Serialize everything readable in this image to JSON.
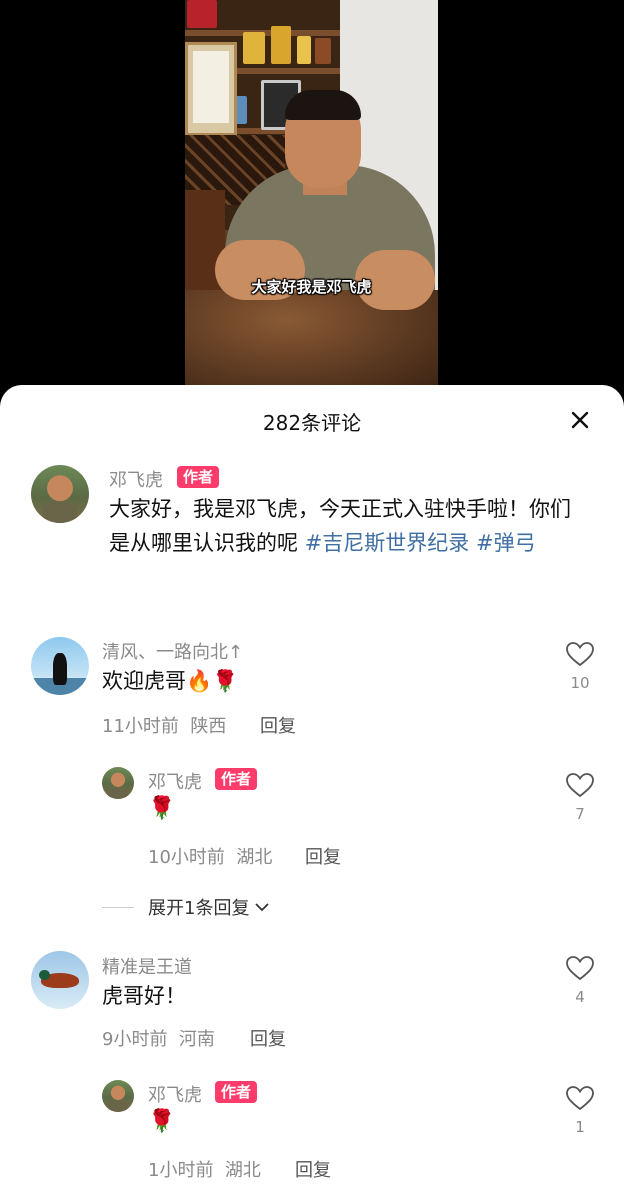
{
  "video": {
    "subtitle": "大家好我是邓飞虎"
  },
  "panel": {
    "title": "282条评论",
    "close_icon": "close-icon"
  },
  "author_post": {
    "name": "邓飞虎",
    "badge": "作者",
    "text": "大家好，我是邓飞虎，今天正式入驻快手啦！你们是从哪里认识我的呢",
    "hashtags": [
      "#吉尼斯世界纪录",
      "#弹弓"
    ]
  },
  "comments": [
    {
      "name": "清风、一路向北↑",
      "text": "欢迎虎哥🔥🌹",
      "time": "11小时前",
      "location": "陕西",
      "reply_label": "回复",
      "likes": "10",
      "replies": [
        {
          "name": "邓飞虎",
          "badge": "作者",
          "text": "🌹",
          "time": "10小时前",
          "location": "湖北",
          "reply_label": "回复",
          "likes": "7"
        }
      ],
      "expand_label": "展开1条回复"
    },
    {
      "name": "精准是王道",
      "text": "虎哥好！",
      "time": "9小时前",
      "location": "河南",
      "reply_label": "回复",
      "likes": "4",
      "replies": [
        {
          "name": "邓飞虎",
          "badge": "作者",
          "text": "🌹",
          "time": "1小时前",
          "location": "湖北",
          "reply_label": "回复",
          "likes": "1"
        }
      ]
    }
  ],
  "colors": {
    "badge": "#fe3c6b",
    "hashtag": "#3f6fa3",
    "muted": "#8a8a8a"
  }
}
